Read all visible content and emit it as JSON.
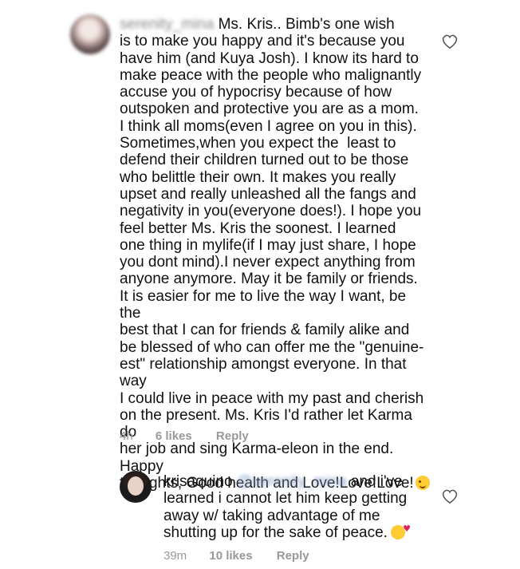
{
  "comments": [
    {
      "username": "serenity_mina",
      "text": "Ms. Kris.. Bimb's one wish\nis to make you happy and it's because you\nhave him (and Kuya Josh). I know its hard to\nmake peace with the people who malignantly\naccuse you of hypocrisy because of how\noutspoken and protective you are as a mom.\nI think all moms(even I agree on you in this).\nSometimes,when you expect the  least to\ndefend their children turned out to be those\nwho belittle their own. It makes you really\nupset and really unleashed all the fangs and\nnegativity in you(everyone does!). I hope you\nfeel better Ms. Kris the soonest. I learned\none thing in mylife(if I may just share, I hope\nyou dont mind).I never expect anything from\nanyone anymore. May it be family or friends.\nIt is easier for me to live the way I want, be the\nbest that I can for friends & family alike and\nbe blessed of who can offer me the \"genuine-\nest\" relationship amongst everyone. In that way\nI could live in peace with my past and cherish\non the present. Ms. Kris I'd rather let Karma do\nher job and sing Karma-eleon in the end. Happy\nthoughts, Good health and Love!Love!Love!",
      "emoji": "smiling-wink-emoji",
      "time": "4h",
      "likes": "6 likes",
      "reply": "Reply"
    },
    {
      "username": "krisaquino",
      "mention": "@serenity_mina",
      "text_after_mention": " and i've\nlearned i cannot let him keep getting\naway w/ taking advantage of me\nshutting up for the sake of peace.",
      "emoji": "kiss-emoji",
      "time": "39m",
      "likes": "10 likes",
      "reply": "Reply"
    }
  ],
  "colors": {
    "text": "#111111",
    "meta": "#999999",
    "mention": "#8aa0c7",
    "heart_stroke": "#555555"
  },
  "icons": {
    "like": "heart-outline-icon"
  }
}
